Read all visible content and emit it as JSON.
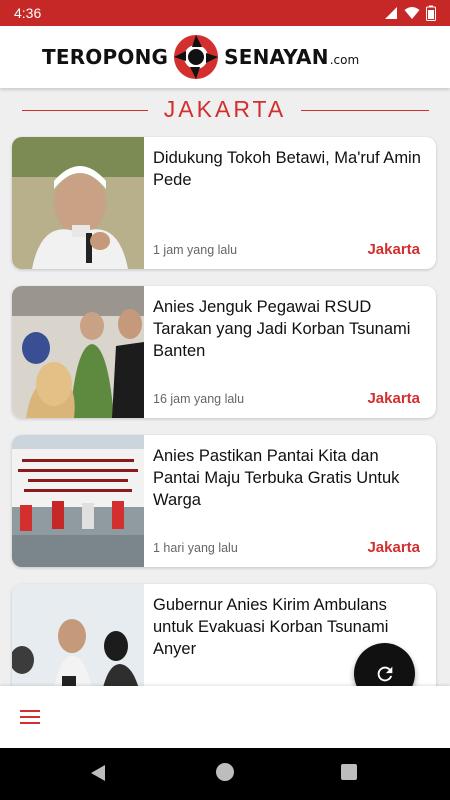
{
  "status_bar": {
    "time": "4:36"
  },
  "app": {
    "logo_left": "TEROPONG",
    "logo_right": "SENAYAN",
    "logo_suffix": ".com",
    "brand_color": "#d32f2f"
  },
  "section": {
    "title": "JAKARTA"
  },
  "articles": [
    {
      "title": "Didukung Tokoh Betawi, Ma'ruf Amin Pede",
      "time": "1 jam yang lalu",
      "category": "Jakarta"
    },
    {
      "title": "Anies Jenguk Pegawai RSUD Tarakan yang Jadi Korban Tsunami Banten",
      "time": "16 jam yang lalu",
      "category": "Jakarta"
    },
    {
      "title": "Anies Pastikan Pantai Kita dan Pantai Maju Terbuka Gratis Untuk Warga",
      "time": "1 hari yang lalu",
      "category": "Jakarta"
    },
    {
      "title": "Gubernur Anies Kirim Ambulans untuk Evakuasi Korban Tsunami Anyer",
      "time": "",
      "category": ""
    }
  ],
  "fab": {
    "icon": "refresh-icon"
  },
  "bottom_bar": {
    "icon": "menu-icon"
  }
}
